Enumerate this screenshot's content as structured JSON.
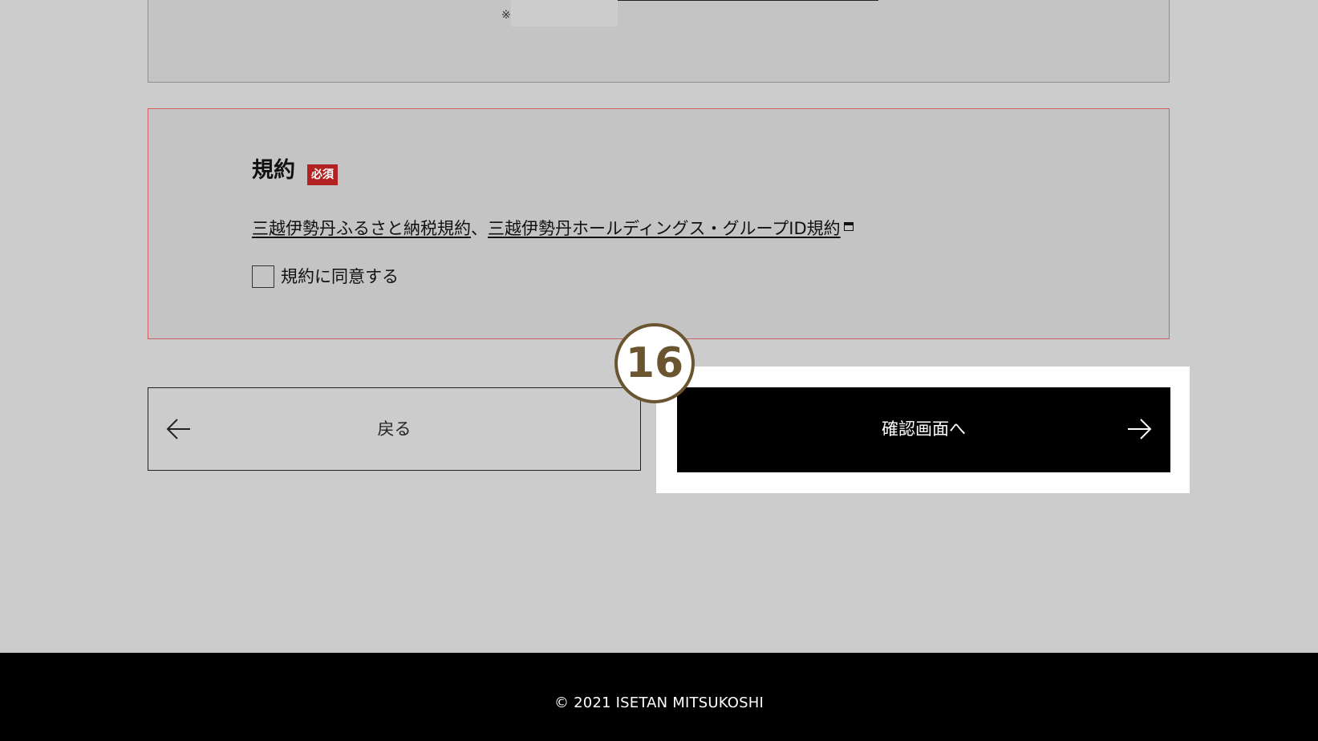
{
  "colors": {
    "page_background": "#cccccc",
    "panel_background": "#c4c4c4",
    "required_red": "#b22222",
    "error_border": "#cf6060",
    "primary_button": "#000000",
    "step_marker": "#6b5530",
    "highlight": "#ffffff"
  },
  "top_panel": {
    "note_mark": "※"
  },
  "terms": {
    "title": "規約",
    "required_badge": "必須",
    "link_furusato": "三越伊勢丹ふるさと納税規約",
    "separator": "、",
    "link_group_id": "三越伊勢丹ホールディングス・グループID規約",
    "external_icon": "external-window-icon",
    "agree_label": "規約に同意する"
  },
  "buttons": {
    "back_label": "戻る",
    "back_icon": "arrow-left-icon",
    "confirm_label": "確認画面へ",
    "confirm_icon": "arrow-right-icon"
  },
  "step_marker": {
    "number": "16"
  },
  "footer": {
    "copyright": "© 2021 ISETAN MITSUKOSHI"
  }
}
